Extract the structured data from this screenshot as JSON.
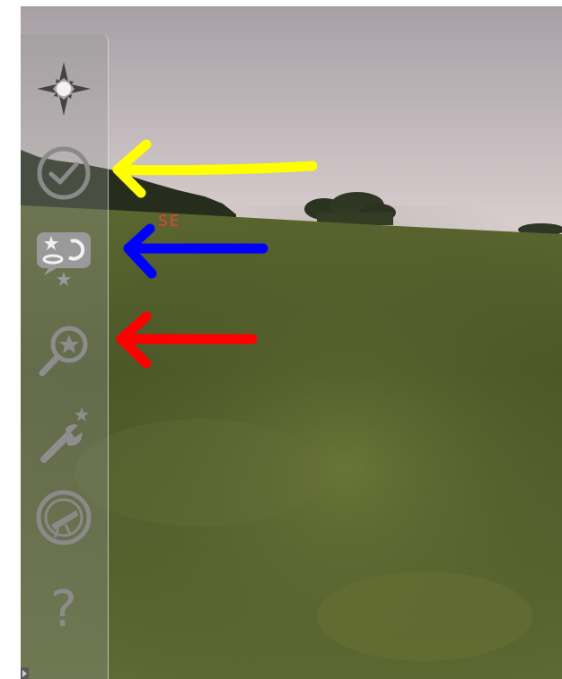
{
  "view": {
    "compass_direction": "SE"
  },
  "sidebar": {
    "items": [
      {
        "icon": "sun-burst-icon",
        "action": "night-mode"
      },
      {
        "icon": "checkmark-circle-icon",
        "action": "selection"
      },
      {
        "icon": "sky-gallery-icon",
        "action": "gallery"
      },
      {
        "icon": "search-star-icon",
        "action": "search"
      },
      {
        "icon": "wrench-star-icon",
        "action": "settings"
      },
      {
        "icon": "compass-telescope-icon",
        "action": "calibrate"
      },
      {
        "icon": "question-mark-icon",
        "action": "help",
        "label": "?"
      }
    ]
  },
  "annotations": {
    "arrow_colors": [
      "#ffff00",
      "#0000ff",
      "#ff0000"
    ]
  },
  "colors": {
    "sky_top": "#a8a0a4",
    "sky_horizon": "#d8cccc",
    "grass_dark": "#3f4a22",
    "grass_light": "#6f7a3a"
  }
}
